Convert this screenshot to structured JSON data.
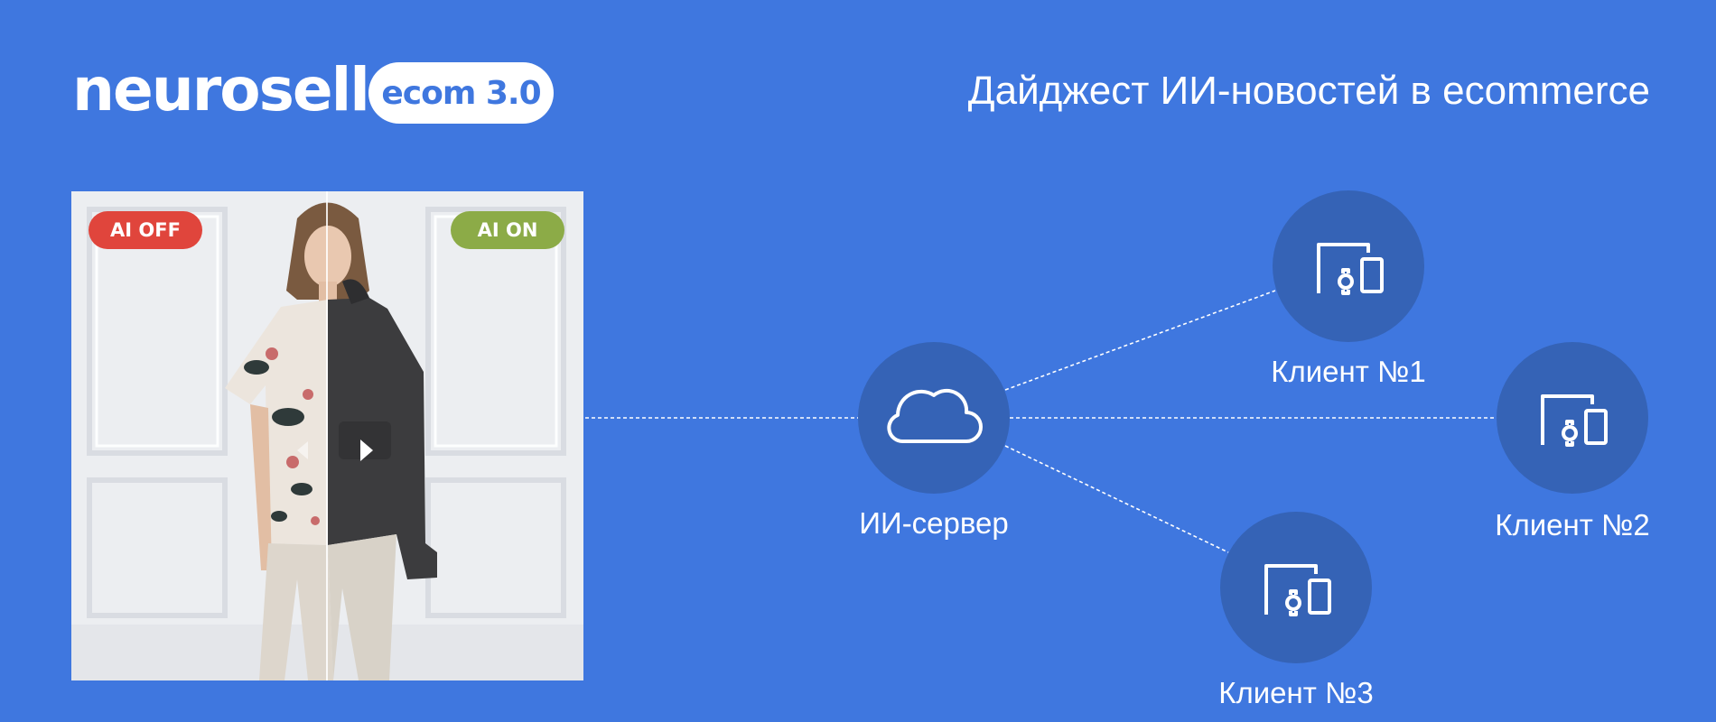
{
  "header": {
    "logo_text": "neurosell",
    "badge_text": "ecom 3.0",
    "title": "Дайджест ИИ-новостей в ecommerce"
  },
  "photo": {
    "ai_off_label": "AI OFF",
    "ai_on_label": "AI ON"
  },
  "diagram": {
    "server": {
      "label": "ИИ-сервер",
      "icon": "cloud-icon"
    },
    "clients": [
      {
        "label": "Клиент №1",
        "icon": "devices-icon"
      },
      {
        "label": "Клиент №2",
        "icon": "devices-icon"
      },
      {
        "label": "Клиент №3",
        "icon": "devices-icon"
      }
    ]
  },
  "colors": {
    "background": "#3f77df",
    "node_fill": "#3563b6",
    "ai_off": "#e0453c",
    "ai_on": "#8cab47"
  }
}
